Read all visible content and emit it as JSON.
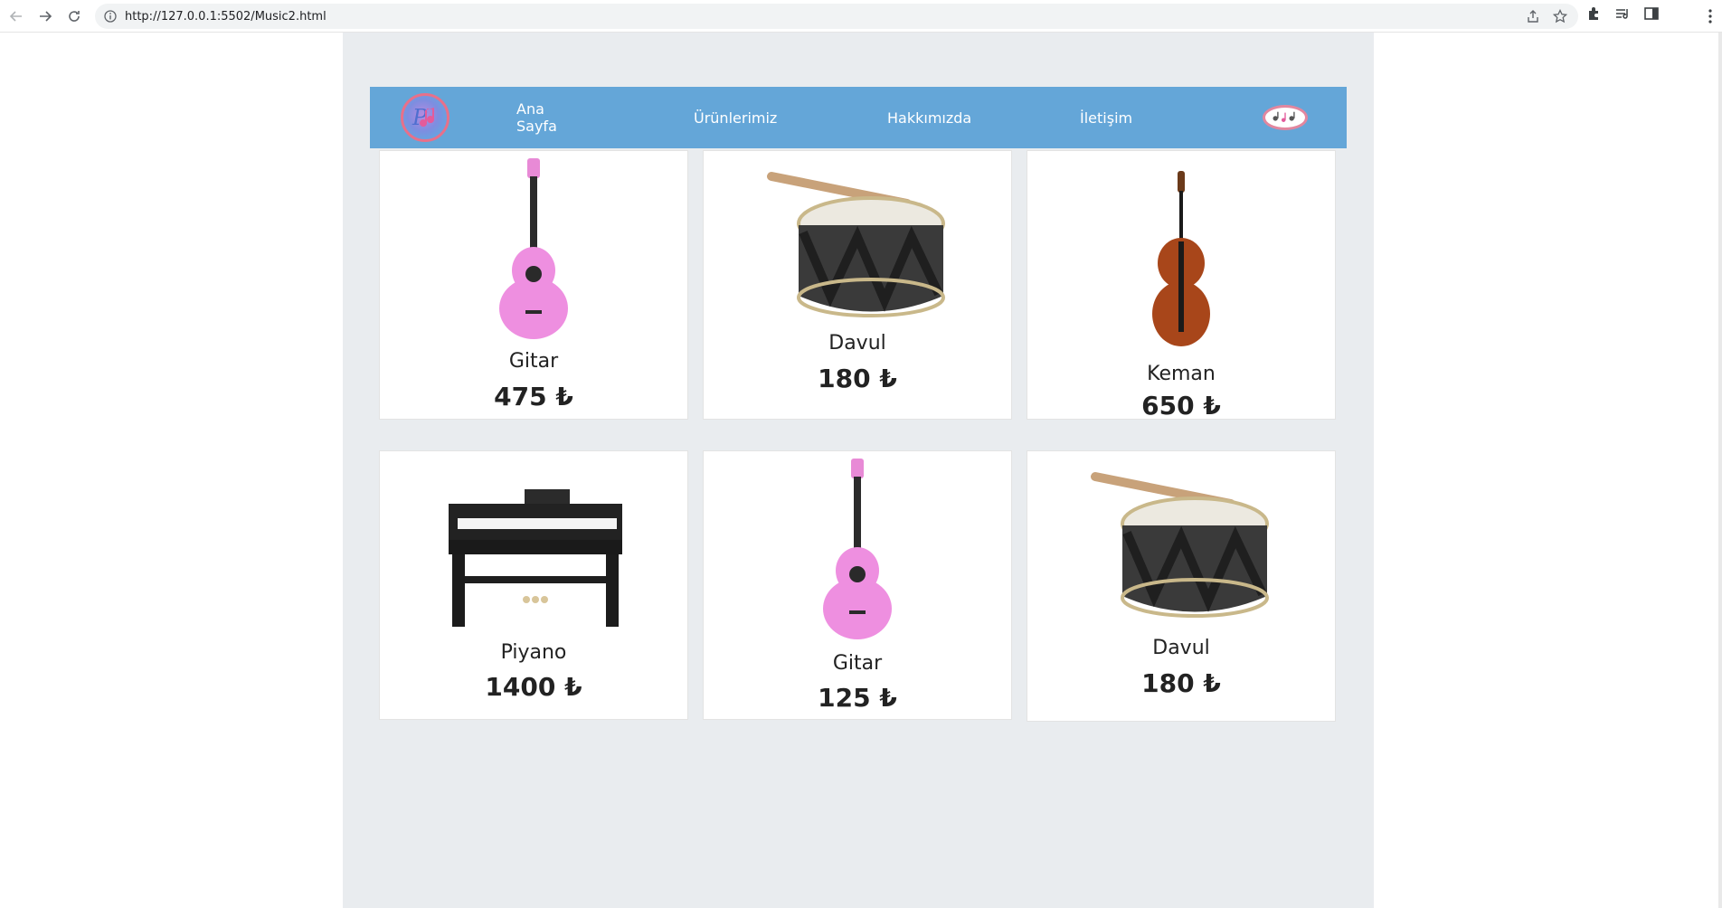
{
  "browser": {
    "url": "http://127.0.0.1:5502/Music2.html"
  },
  "navbar": {
    "links": [
      "Ana Sayfa",
      "Ürünlerimiz",
      "Hakkımızda",
      "İletişim"
    ]
  },
  "products": [
    {
      "name": "Gitar",
      "price": "475 ₺",
      "icon": "pink-guitar"
    },
    {
      "name": "Davul",
      "price": "180 ₺",
      "icon": "drum"
    },
    {
      "name": "Keman",
      "price": "650 ₺",
      "icon": "violin"
    },
    {
      "name": "Piyano",
      "price": "1400 ₺",
      "icon": "piano"
    },
    {
      "name": "Gitar",
      "price": "125 ₺",
      "icon": "pink-guitar"
    },
    {
      "name": "Davul",
      "price": "180 ₺",
      "icon": "drum"
    }
  ],
  "colors": {
    "navbar": "#64a6d8",
    "wrapper": "#e9ecef",
    "logo_ring": "#e8708a"
  }
}
